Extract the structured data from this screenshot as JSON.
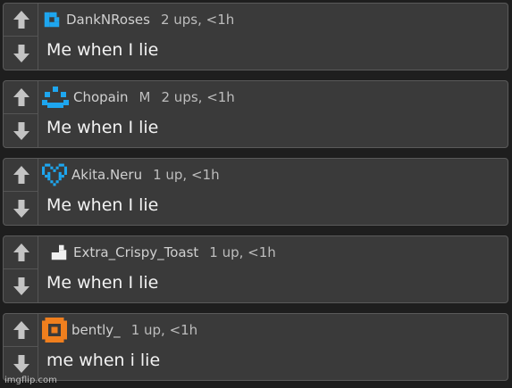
{
  "colors": {
    "background": "#1e1e1e",
    "card": "#3a3a3a",
    "card_border": "#5a5a5a",
    "arrow": "#c4c4c4",
    "username": "#d0d0d0",
    "meta": "#bdbdbd",
    "body_text": "#f2f2f2"
  },
  "comments": [
    {
      "username": "DankNRoses",
      "badge": "",
      "meta": "2 ups, <1h",
      "text": "Me when I lie",
      "avatar": "blue-pixel-square-icon",
      "avatar_color": "#1ea6ef"
    },
    {
      "username": "Chopain",
      "badge": "M",
      "meta": "2 ups, <1h",
      "text": "Me when I lie",
      "avatar": "blue-pixel-smiley-icon",
      "avatar_color": "#1ea6ef"
    },
    {
      "username": "Akita.Neru",
      "badge": "",
      "meta": "1 up, <1h",
      "text": "Me when I lie",
      "avatar": "blue-pixel-heart-icon",
      "avatar_color": "#1ea6ef"
    },
    {
      "username": "Extra_Crispy_Toast",
      "badge": "",
      "meta": "1 up, <1h",
      "text": "Me when I lie",
      "avatar": "white-pixel-step-icon",
      "avatar_color": "#f0f0f0"
    },
    {
      "username": "bently_",
      "badge": "",
      "meta": "1 up, <1h",
      "text": "me when i lie",
      "avatar": "orange-pixel-ring-icon",
      "avatar_color": "#f07f1e"
    }
  ],
  "watermark": "imgflip.com"
}
